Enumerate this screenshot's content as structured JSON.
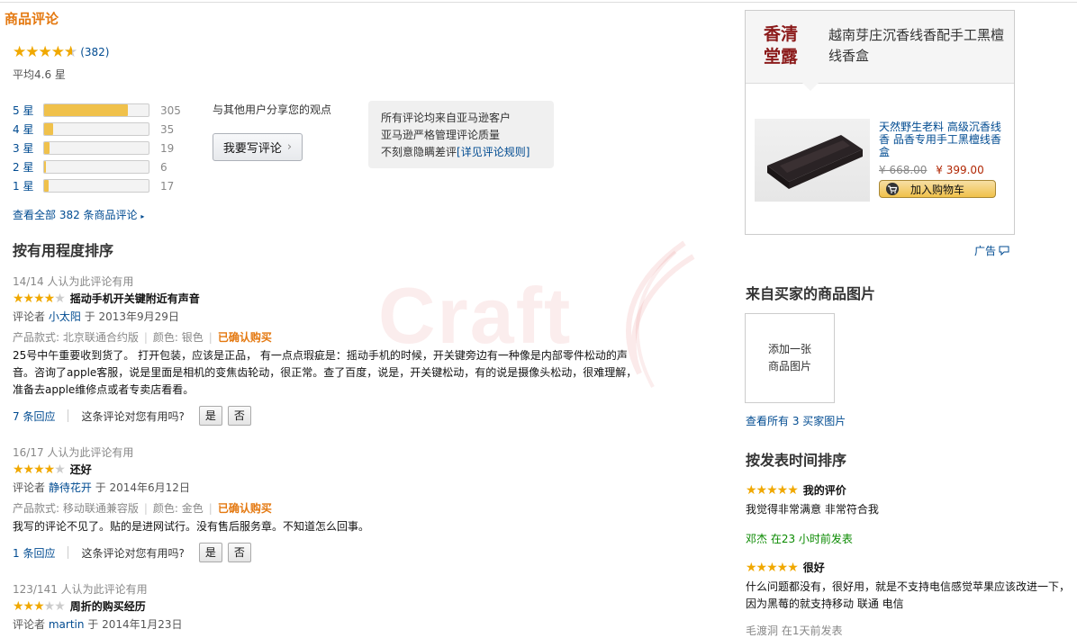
{
  "section_title": "商品评论",
  "summary": {
    "rating": 4.6,
    "count_text": "(382)",
    "average_text": "平均4.6 星",
    "histogram": [
      {
        "label": "5 星",
        "count": "305",
        "fraction": 0.8
      },
      {
        "label": "4 星",
        "count": "35",
        "fraction": 0.09
      },
      {
        "label": "3 星",
        "count": "19",
        "fraction": 0.05
      },
      {
        "label": "2 星",
        "count": "6",
        "fraction": 0.02
      },
      {
        "label": "1 星",
        "count": "17",
        "fraction": 0.04
      }
    ],
    "share_text": "与其他用户分享您的观点",
    "write_button": "我要写评论",
    "info_lines": [
      "所有评论均来自亚马逊客户",
      "亚马逊严格管理评论质量",
      "不刻意隐瞒差评"
    ],
    "info_link": "[详见评论规则]",
    "see_all": "查看全部 382 条商品评论"
  },
  "sort_title": "按有用程度排序",
  "reviews": [
    {
      "helpful": "14/14 人认为此评论有用",
      "stars": 4,
      "title": "摇动手机开关键附近有声音",
      "byline_prefix": "评论者",
      "author": "小太阳",
      "date": "于 2013年9月29日",
      "model": "产品款式: 北京联通合约版",
      "color": "颜色: 银色",
      "verified": "已确认购买",
      "body": "25号中午重要收到货了。 打开包装，应该是正品， 有一点点瑕疵是：摇动手机的时候，开关键旁边有一种像是内部零件松动的声音。咨询了apple客服，说是里面是相机的变焦齿轮动，很正常。查了百度，说是，开关键松动，有的说是摄像头松动，很难理解， 准备去apple维修点或者专卖店看看。",
      "replies": "7 条回应",
      "question": "这条评论对您有用吗?",
      "yes": "是",
      "no": "否"
    },
    {
      "helpful": "16/17 人认为此评论有用",
      "stars": 4,
      "title": "还好",
      "byline_prefix": "评论者",
      "author": "静待花开",
      "date": "于 2014年6月12日",
      "model": "产品款式: 移动联通兼容版",
      "color": "颜色: 金色",
      "verified": "已确认购买",
      "body": "我写的评论不见了。贴的是进网试行。没有售后服务章。不知道怎么回事。",
      "replies": "1 条回应",
      "question": "这条评论对您有用吗?",
      "yes": "是",
      "no": "否"
    },
    {
      "helpful": "123/141 人认为此评论有用",
      "stars": 3,
      "title": "周折的购买经历",
      "byline_prefix": "评论者",
      "author": "martin",
      "date": "于 2014年1月23日"
    }
  ],
  "watermark": "Craft",
  "ad": {
    "logo": "香清堂露",
    "headline": "越南芽庄沉香线香配手工黑檀线香盒",
    "product_title": "天然野生老料 高级沉香线香 品香专用手工黑檀线香盒",
    "old_price": "¥ 668.00",
    "new_price": "¥ 399.00",
    "cart_button": "加入购物车",
    "ad_label": "广告"
  },
  "buyer_images": {
    "title": "来自买家的商品图片",
    "add_text": "添加一张商品图片",
    "see_all": "查看所有 3 买家图片"
  },
  "time_sort": {
    "title": "按发表时间排序",
    "items": [
      {
        "stars": 5,
        "title": "我的评价",
        "body": "我觉得非常满意 非常符合我",
        "author": "邓杰 在23 小时前发表"
      },
      {
        "stars": 5,
        "title": "很好",
        "body": "什么问题都没有，很好用，就是不支持电信感觉苹果应该改进一下，因为黑莓的就支持移动 联通 电信",
        "author": ""
      }
    ],
    "cut_text": "毛渡洞 在1天前发表"
  },
  "colors": {
    "accent": "#e47911",
    "link": "#004b91",
    "star": "#f0a800",
    "price": "#b12704"
  }
}
